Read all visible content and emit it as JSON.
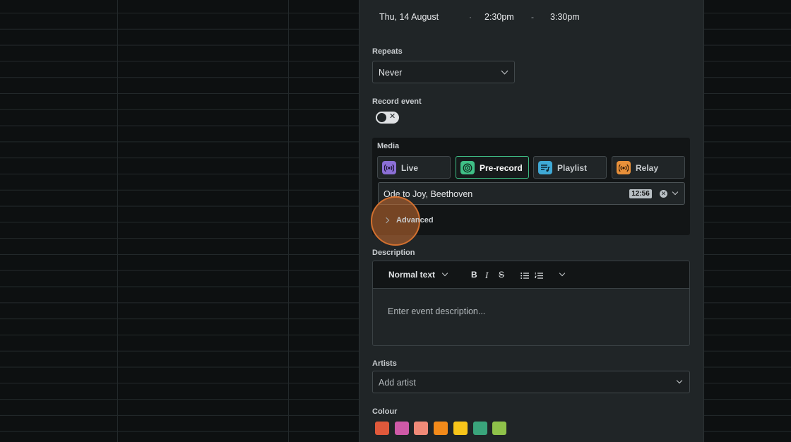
{
  "schedule": {
    "date": "Thu, 14 August",
    "dot_sep": "·",
    "start_time": "2:30pm",
    "dash_sep": "-",
    "end_time": "3:30pm"
  },
  "repeats": {
    "label": "Repeats",
    "value": "Never"
  },
  "record_event": {
    "label": "Record event",
    "enabled": false,
    "toggle_glyph": "✕"
  },
  "media": {
    "label": "Media",
    "options": [
      {
        "label": "Live",
        "icon": "broadcast-icon",
        "color": "#8b6fd6",
        "active": false
      },
      {
        "label": "Pre-record",
        "icon": "vinyl-icon",
        "color": "#3fbf86",
        "active": true
      },
      {
        "label": "Playlist",
        "icon": "playlist-icon",
        "color": "#3fa9d6",
        "active": false
      },
      {
        "label": "Relay",
        "icon": "relay-icon",
        "color": "#e8903a",
        "active": false
      }
    ],
    "track": {
      "title": "Ode to Joy, Beethoven",
      "duration": "12:56",
      "clear_glyph": "✕"
    },
    "advanced_label": "Advanced"
  },
  "description": {
    "label": "Description",
    "text_style": "Normal text",
    "bold_glyph": "B",
    "italic_glyph": "I",
    "strike_glyph": "S",
    "placeholder": "Enter event description..."
  },
  "artists": {
    "label": "Artists",
    "placeholder": "Add artist"
  },
  "colour": {
    "label": "Colour",
    "swatches": [
      "#e0593b",
      "#cf5aa8",
      "#f08a78",
      "#f28a1a",
      "#f7c51a",
      "#3aa57c",
      "#8fc24a"
    ]
  }
}
